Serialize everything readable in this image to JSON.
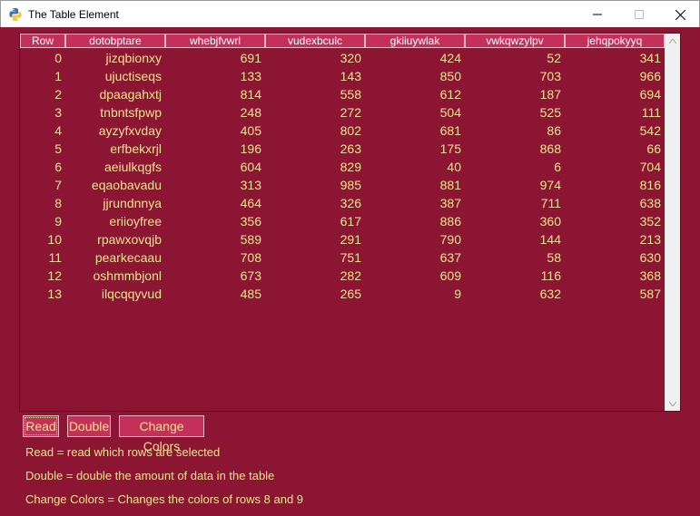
{
  "window": {
    "title": "The Table Element",
    "minimize_glyph": "—",
    "maximize_glyph": "☐",
    "close_glyph": "✕"
  },
  "colors": {
    "background": "#8b1532",
    "header_bg": "#c4305a",
    "text": "#f6e28f"
  },
  "table": {
    "headers": [
      "Row",
      "dotobptare",
      "whebjfvwrl",
      "vudexbculc",
      "gkiiuywlak",
      "vwkqwzylpv",
      "jehqpokyyq"
    ],
    "rows": [
      [
        "0",
        "jizqbionxy",
        "691",
        "320",
        "424",
        "52",
        "341"
      ],
      [
        "1",
        "ujuctiseqs",
        "133",
        "143",
        "850",
        "703",
        "966"
      ],
      [
        "2",
        "dpaagahxtj",
        "814",
        "558",
        "612",
        "187",
        "694"
      ],
      [
        "3",
        "tnbntsfpwp",
        "248",
        "272",
        "504",
        "525",
        "111"
      ],
      [
        "4",
        "ayzyfxvday",
        "405",
        "802",
        "681",
        "86",
        "542"
      ],
      [
        "5",
        "erfbekxrjl",
        "196",
        "263",
        "175",
        "868",
        "66"
      ],
      [
        "6",
        "aeiulkqgfs",
        "604",
        "829",
        "40",
        "6",
        "704"
      ],
      [
        "7",
        "eqaobavadu",
        "313",
        "985",
        "881",
        "974",
        "816"
      ],
      [
        "8",
        "jjrundnnya",
        "464",
        "326",
        "387",
        "711",
        "638"
      ],
      [
        "9",
        "eriioyfree",
        "356",
        "617",
        "886",
        "360",
        "352"
      ],
      [
        "10",
        "rpawxovqjb",
        "589",
        "291",
        "790",
        "144",
        "213"
      ],
      [
        "11",
        "pearkecaau",
        "708",
        "751",
        "637",
        "58",
        "630"
      ],
      [
        "12",
        "oshmmbjonl",
        "673",
        "282",
        "609",
        "116",
        "368"
      ],
      [
        "13",
        "ilqcqqyvud",
        "485",
        "265",
        "9",
        "632",
        "587"
      ]
    ]
  },
  "buttons": {
    "read": "Read",
    "double": "Double",
    "change_colors": "Change Colors"
  },
  "info": {
    "line1": "Read = read which rows are selected",
    "line2": "Double = double the amount of data in the table",
    "line3": "Change Colors = Changes the colors of rows 8 and 9"
  }
}
